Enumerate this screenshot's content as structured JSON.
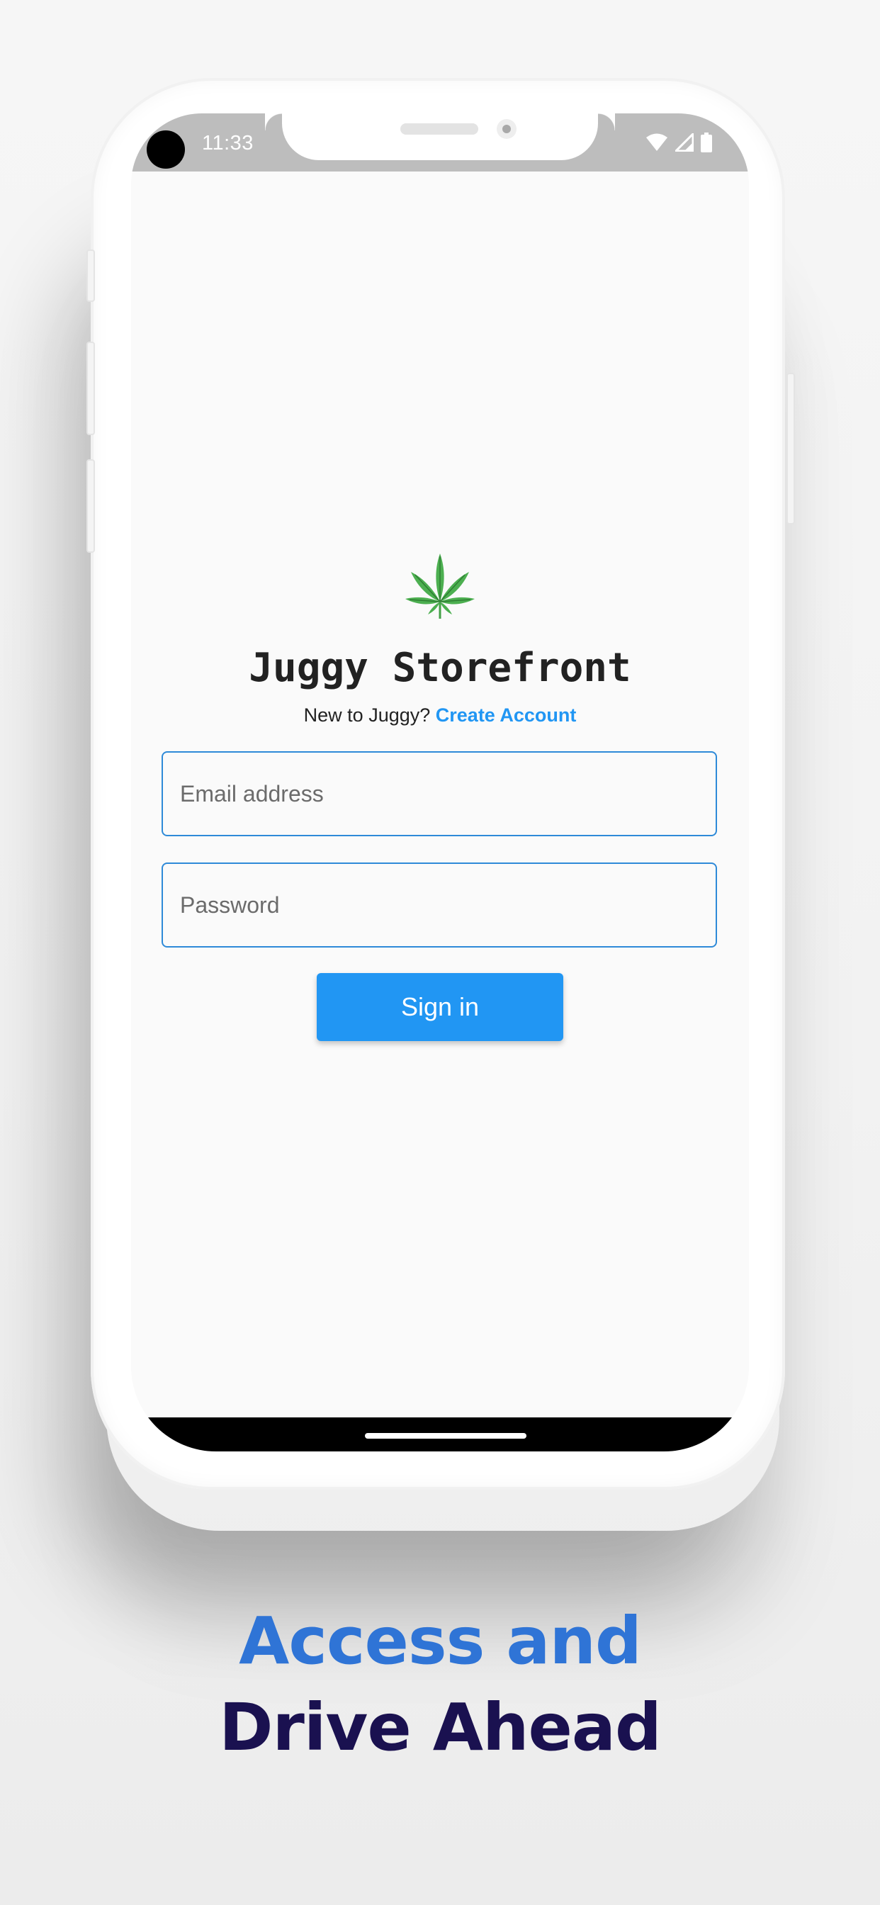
{
  "status_bar": {
    "time": "11:33",
    "icons": [
      "wifi-icon",
      "signal-icon",
      "battery-icon"
    ]
  },
  "login": {
    "logo_icon": "cannabis-leaf-icon",
    "title": "Juggy Storefront",
    "signup_prompt": "New to Juggy?",
    "signup_link": "Create Account",
    "email_placeholder": "Email address",
    "password_placeholder": "Password",
    "signin_label": "Sign in"
  },
  "tagline": {
    "line1": "Access and",
    "line2": "Drive Ahead"
  },
  "colors": {
    "accent": "#2196f3",
    "tagline_blue": "#2f74d6",
    "tagline_navy": "#1a1150",
    "leaf_green": "#4caf50"
  }
}
